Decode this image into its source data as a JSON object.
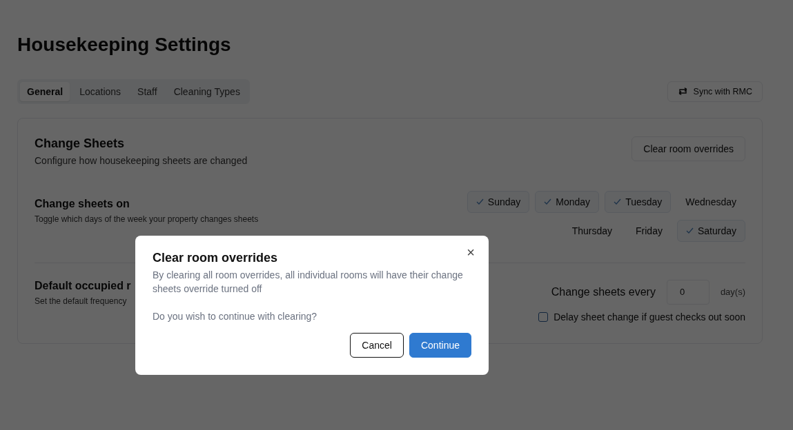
{
  "page": {
    "title": "Housekeeping Settings"
  },
  "tabs": [
    {
      "label": "General",
      "selected": true
    },
    {
      "label": "Locations",
      "selected": false
    },
    {
      "label": "Staff",
      "selected": false
    },
    {
      "label": "Cleaning Types",
      "selected": false
    }
  ],
  "sync_button": {
    "label": "Sync with RMC"
  },
  "card": {
    "title": "Change Sheets",
    "subtitle": "Configure how housekeeping sheets are changed",
    "action": "Clear room overrides"
  },
  "change_sheets_on": {
    "title": "Change sheets on",
    "description": "Toggle which days of the week your property changes sheets",
    "days": [
      {
        "label": "Sunday",
        "selected": true
      },
      {
        "label": "Monday",
        "selected": true
      },
      {
        "label": "Tuesday",
        "selected": true
      },
      {
        "label": "Wednesday",
        "selected": false
      },
      {
        "label": "Thursday",
        "selected": false
      },
      {
        "label": "Friday",
        "selected": false
      },
      {
        "label": "Saturday",
        "selected": true
      }
    ]
  },
  "default_occupied": {
    "title": "Default occupied r",
    "description": "Set the default frequency",
    "every_label": "Change sheets every",
    "every_value": "0",
    "unit": "day(s)",
    "delay": {
      "label": "Delay sheet change if guest checks out soon",
      "checked": false
    }
  },
  "dialog": {
    "title": "Clear room overrides",
    "message": "By clearing all room overrides, all individual rooms will have their change sheets override turned off",
    "question": "Do you wish to continue with clearing?",
    "close": "×",
    "buttons": [
      {
        "label": "Cancel",
        "kind": "secondary"
      },
      {
        "label": "Continue",
        "kind": "primary"
      }
    ]
  }
}
